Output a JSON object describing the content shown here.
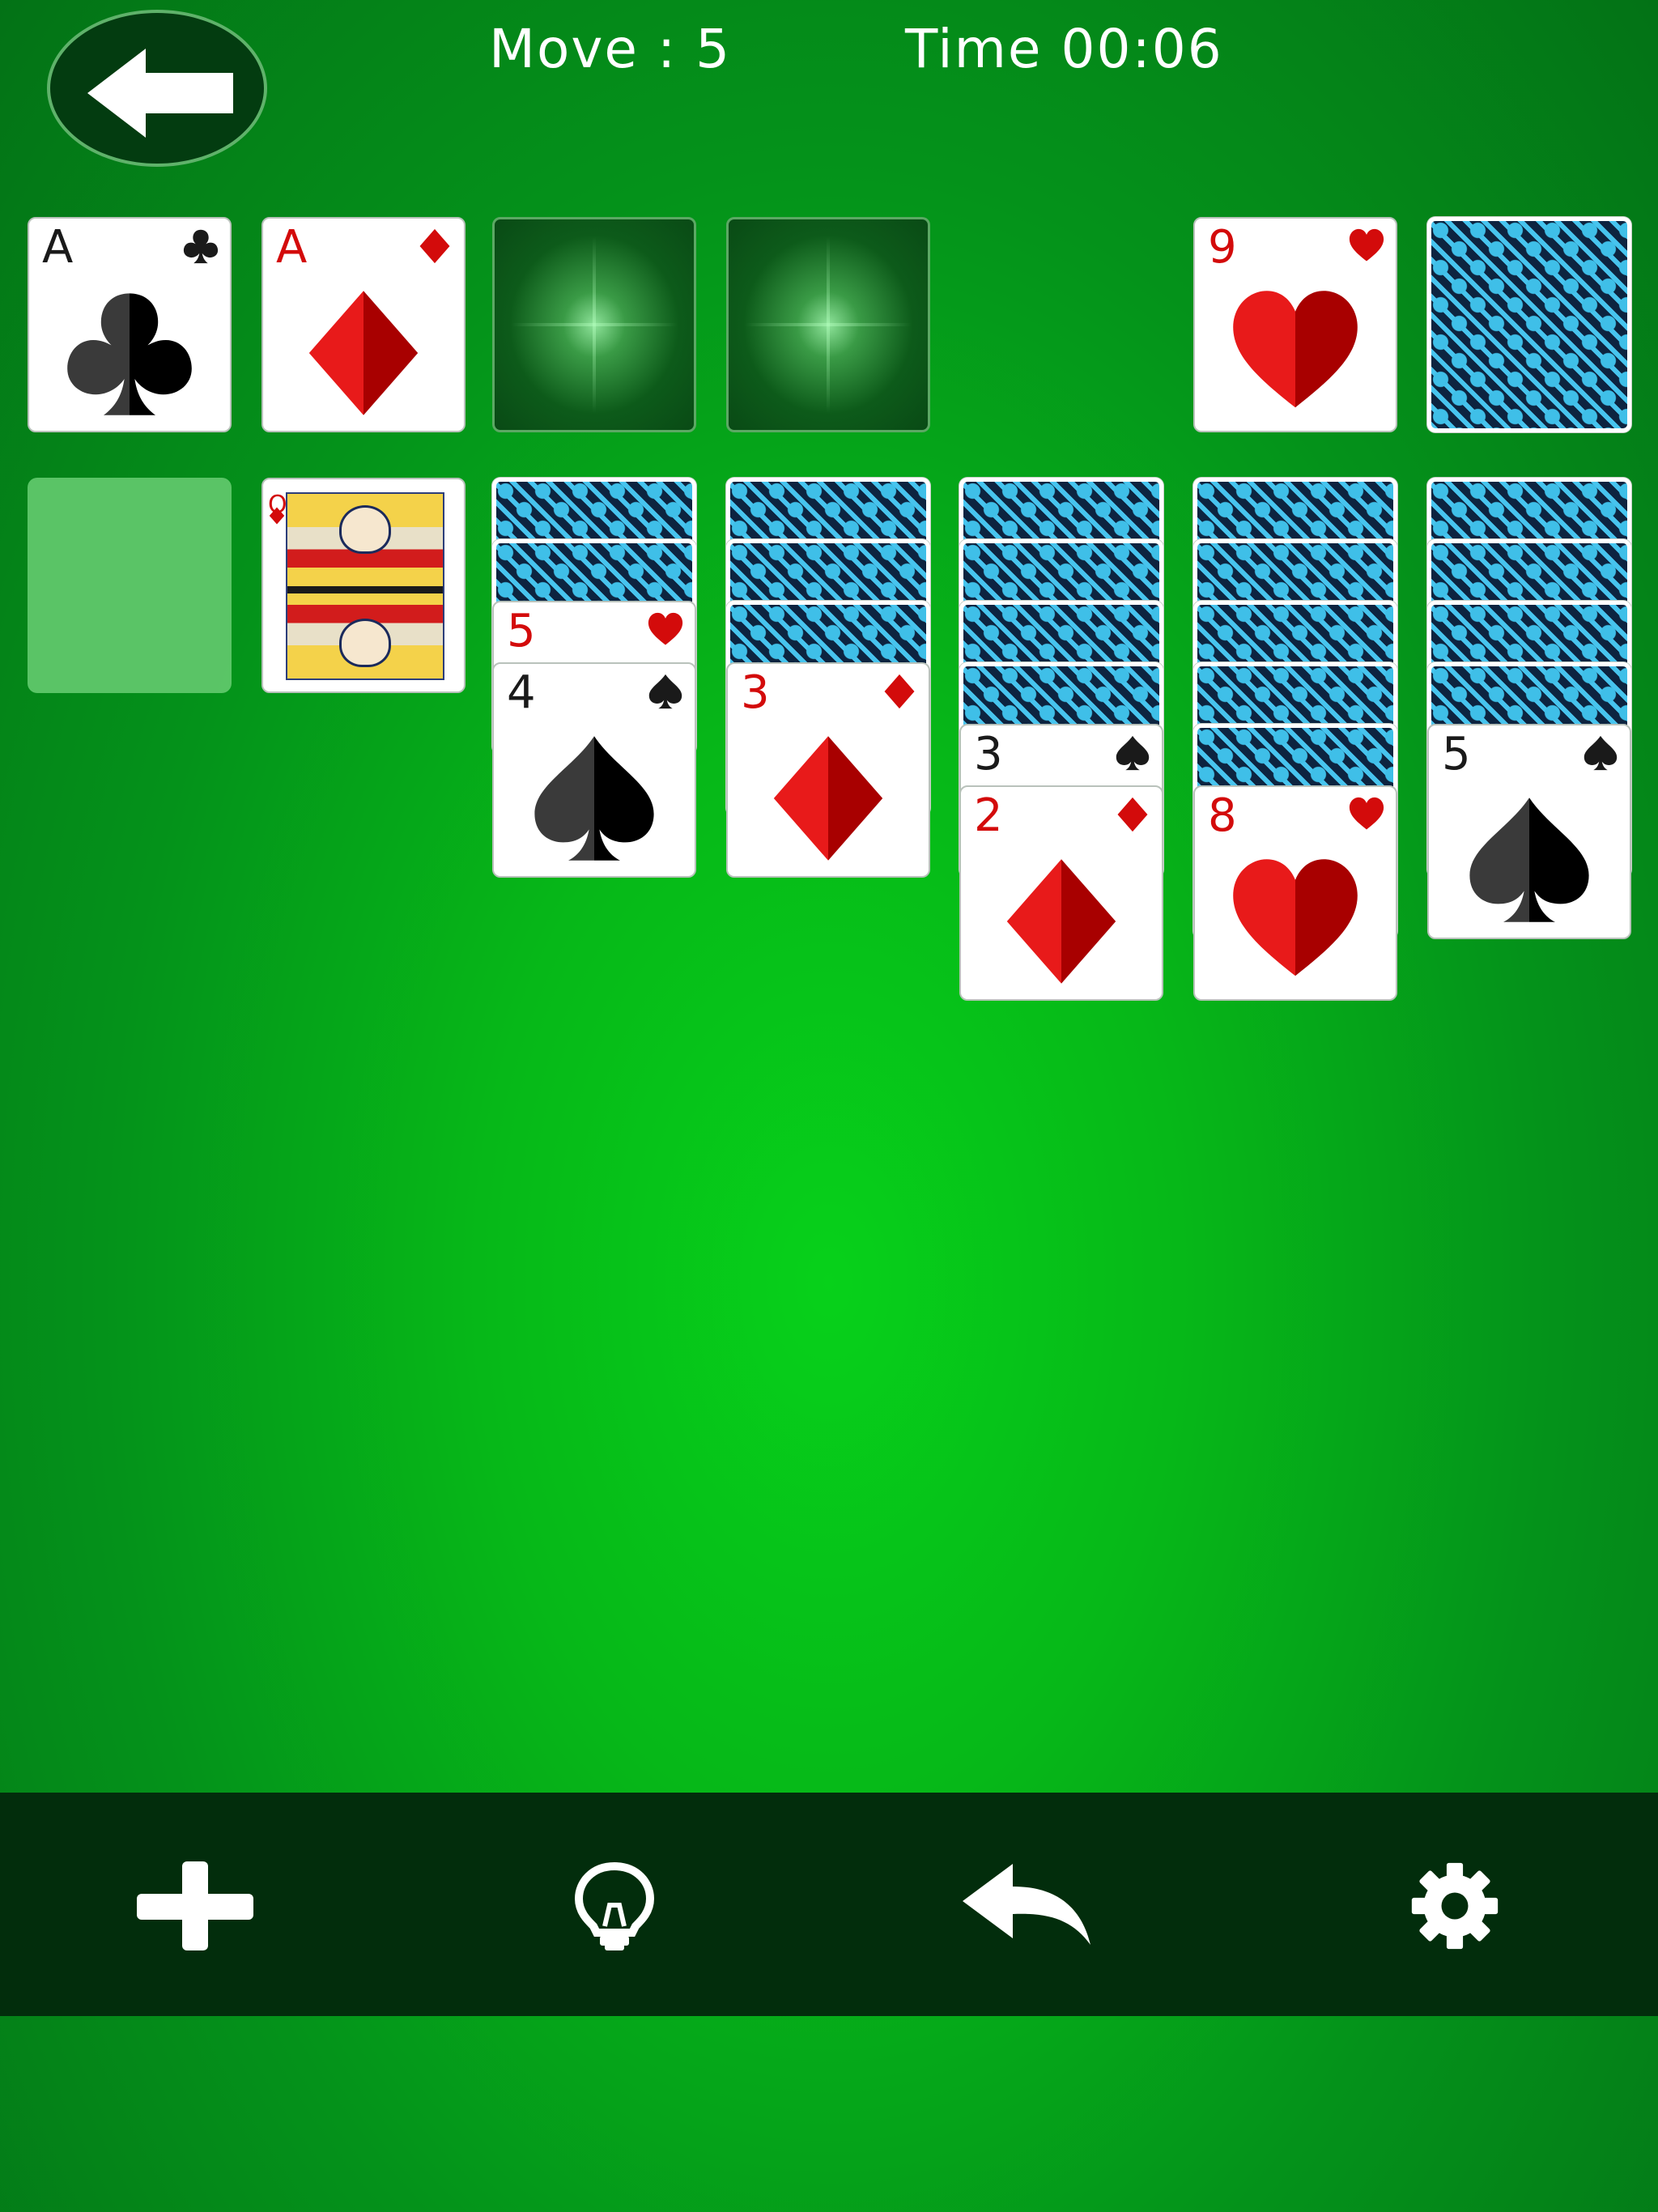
{
  "header": {
    "back_icon": "arrow-left-icon",
    "move_label": "Move : 5",
    "time_label": "Time 00:06"
  },
  "foundations": [
    {
      "rank": "A",
      "suit": "clubs"
    },
    {
      "rank": "A",
      "suit": "diamonds"
    },
    {
      "rank": "",
      "suit": ""
    },
    {
      "rank": "",
      "suit": ""
    }
  ],
  "waste": {
    "rank": "9",
    "suit": "hearts"
  },
  "stock": {
    "face": "down"
  },
  "tableau": [
    {
      "face_down": 0,
      "face_up": []
    },
    {
      "face_down": 0,
      "face_up": [
        {
          "rank": "Q",
          "suit": "diamonds"
        }
      ]
    },
    {
      "face_down": 2,
      "face_up": [
        {
          "rank": "5",
          "suit": "hearts"
        },
        {
          "rank": "4",
          "suit": "spades"
        }
      ]
    },
    {
      "face_down": 3,
      "face_up": [
        {
          "rank": "3",
          "suit": "diamonds"
        }
      ]
    },
    {
      "face_down": 4,
      "face_up": [
        {
          "rank": "3",
          "suit": "spades"
        },
        {
          "rank": "2",
          "suit": "diamonds"
        }
      ]
    },
    {
      "face_down": 5,
      "face_up": [
        {
          "rank": "8",
          "suit": "hearts"
        }
      ]
    },
    {
      "face_down": 4,
      "face_up": [
        {
          "rank": "5",
          "suit": "spades"
        }
      ]
    }
  ],
  "toolbar": {
    "new_game_icon": "plus-icon",
    "hint_icon": "lightbulb-icon",
    "undo_icon": "undo-arrow-icon",
    "settings_icon": "gear-icon"
  },
  "colors": {
    "felt": "#06b818",
    "toolbar": "#022d0c",
    "red_suit": "#d30b0b",
    "black_suit": "#1a1a1a"
  }
}
